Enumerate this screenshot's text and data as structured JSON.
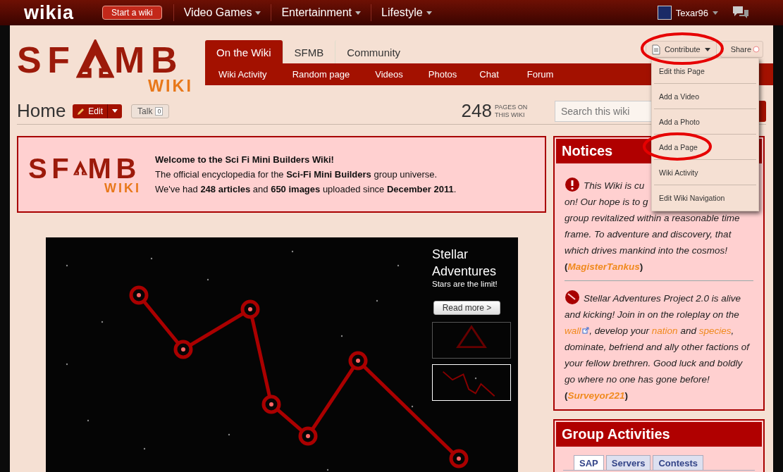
{
  "topbar": {
    "logo": "wikia",
    "start_button": "Start a wiki",
    "nav": [
      {
        "label": "Video Games"
      },
      {
        "label": "Entertainment"
      },
      {
        "label": "Lifestyle"
      }
    ],
    "user": "Texar96"
  },
  "wiki_logo": {
    "left": "SF",
    "right": "MB",
    "sub": "WIKI"
  },
  "tabs": [
    {
      "label": "On the Wiki",
      "selected": true
    },
    {
      "label": "SFMB",
      "selected": false
    },
    {
      "label": "Community",
      "selected": false
    }
  ],
  "subnav": [
    "Wiki Activity",
    "Random page",
    "Videos",
    "Photos",
    "Chat",
    "Forum"
  ],
  "contribute": {
    "label": "Contribute",
    "circled": true
  },
  "share": {
    "label": "Share"
  },
  "contribute_menu": [
    {
      "label": "Edit this Page",
      "circled": false
    },
    {
      "label": "Add a Video",
      "circled": false
    },
    {
      "label": "Add a Photo",
      "circled": false
    },
    {
      "label": "Add a Page",
      "circled": true
    },
    {
      "label": "Wiki Activity",
      "circled": false
    },
    {
      "label": "Edit Wiki Navigation",
      "circled": false
    }
  ],
  "page": {
    "title": "Home",
    "edit": "Edit",
    "talk": "Talk",
    "talk_count": "0",
    "page_count": "248",
    "page_count_label": "PAGES ON THIS WIKI"
  },
  "search": {
    "placeholder": "Search this wiki"
  },
  "welcome": {
    "logo": {
      "left": "SF",
      "right": "MB",
      "sub": "WIKI"
    },
    "title": "Welcome to the Sci Fi Mini Builders Wiki!",
    "lines": [
      "The official encyclopedia for the **Sci-Fi Mini Builders** group universe.",
      "We've had **248 articles** and **650 images** uploaded since **December 2011**."
    ]
  },
  "slider": {
    "title": "Stellar Adventures",
    "subtitle": "Stars are the limit!",
    "button": "Read more >",
    "thumbnails": [
      {
        "selected": false
      },
      {
        "selected": true
      }
    ]
  },
  "notices": {
    "title": "Notices",
    "items": [
      {
        "kind": "alert",
        "lines": [
          "This Wiki is cu",
          "on! Our hope is to g",
          "group revitalized within a reasonable time",
          "frame. To adventure and discovery, that which drives mankind into the cosmos!"
        ],
        "author": {
          "open": "(",
          "name": "MagisterTankus",
          "close": ")"
        }
      },
      {
        "kind": "planet",
        "segments": [
          {
            "kind": "text",
            "text": "Stellar Adventures Project 2.0 is alive and kicking! Join in on the roleplay on the "
          },
          {
            "kind": "external_link",
            "text": "wall"
          },
          {
            "kind": "text",
            "text": ", develop your "
          },
          {
            "kind": "link",
            "text": "nation"
          },
          {
            "kind": "text",
            "text": " and "
          },
          {
            "kind": "link",
            "text": "species"
          },
          {
            "kind": "text",
            "text": ", dominate, befriend and ally other factions of your fellow brethren. Good luck and boldly go where no one has gone before!"
          }
        ],
        "author": {
          "open": "(",
          "name": "Surveyor221",
          "close": ")"
        }
      }
    ]
  },
  "group_activities": {
    "title": "Group Activities",
    "tabs": [
      {
        "label": "SAP",
        "selected": true
      },
      {
        "label": "Servers",
        "selected": false
      },
      {
        "label": "Contests",
        "selected": false
      }
    ]
  }
}
